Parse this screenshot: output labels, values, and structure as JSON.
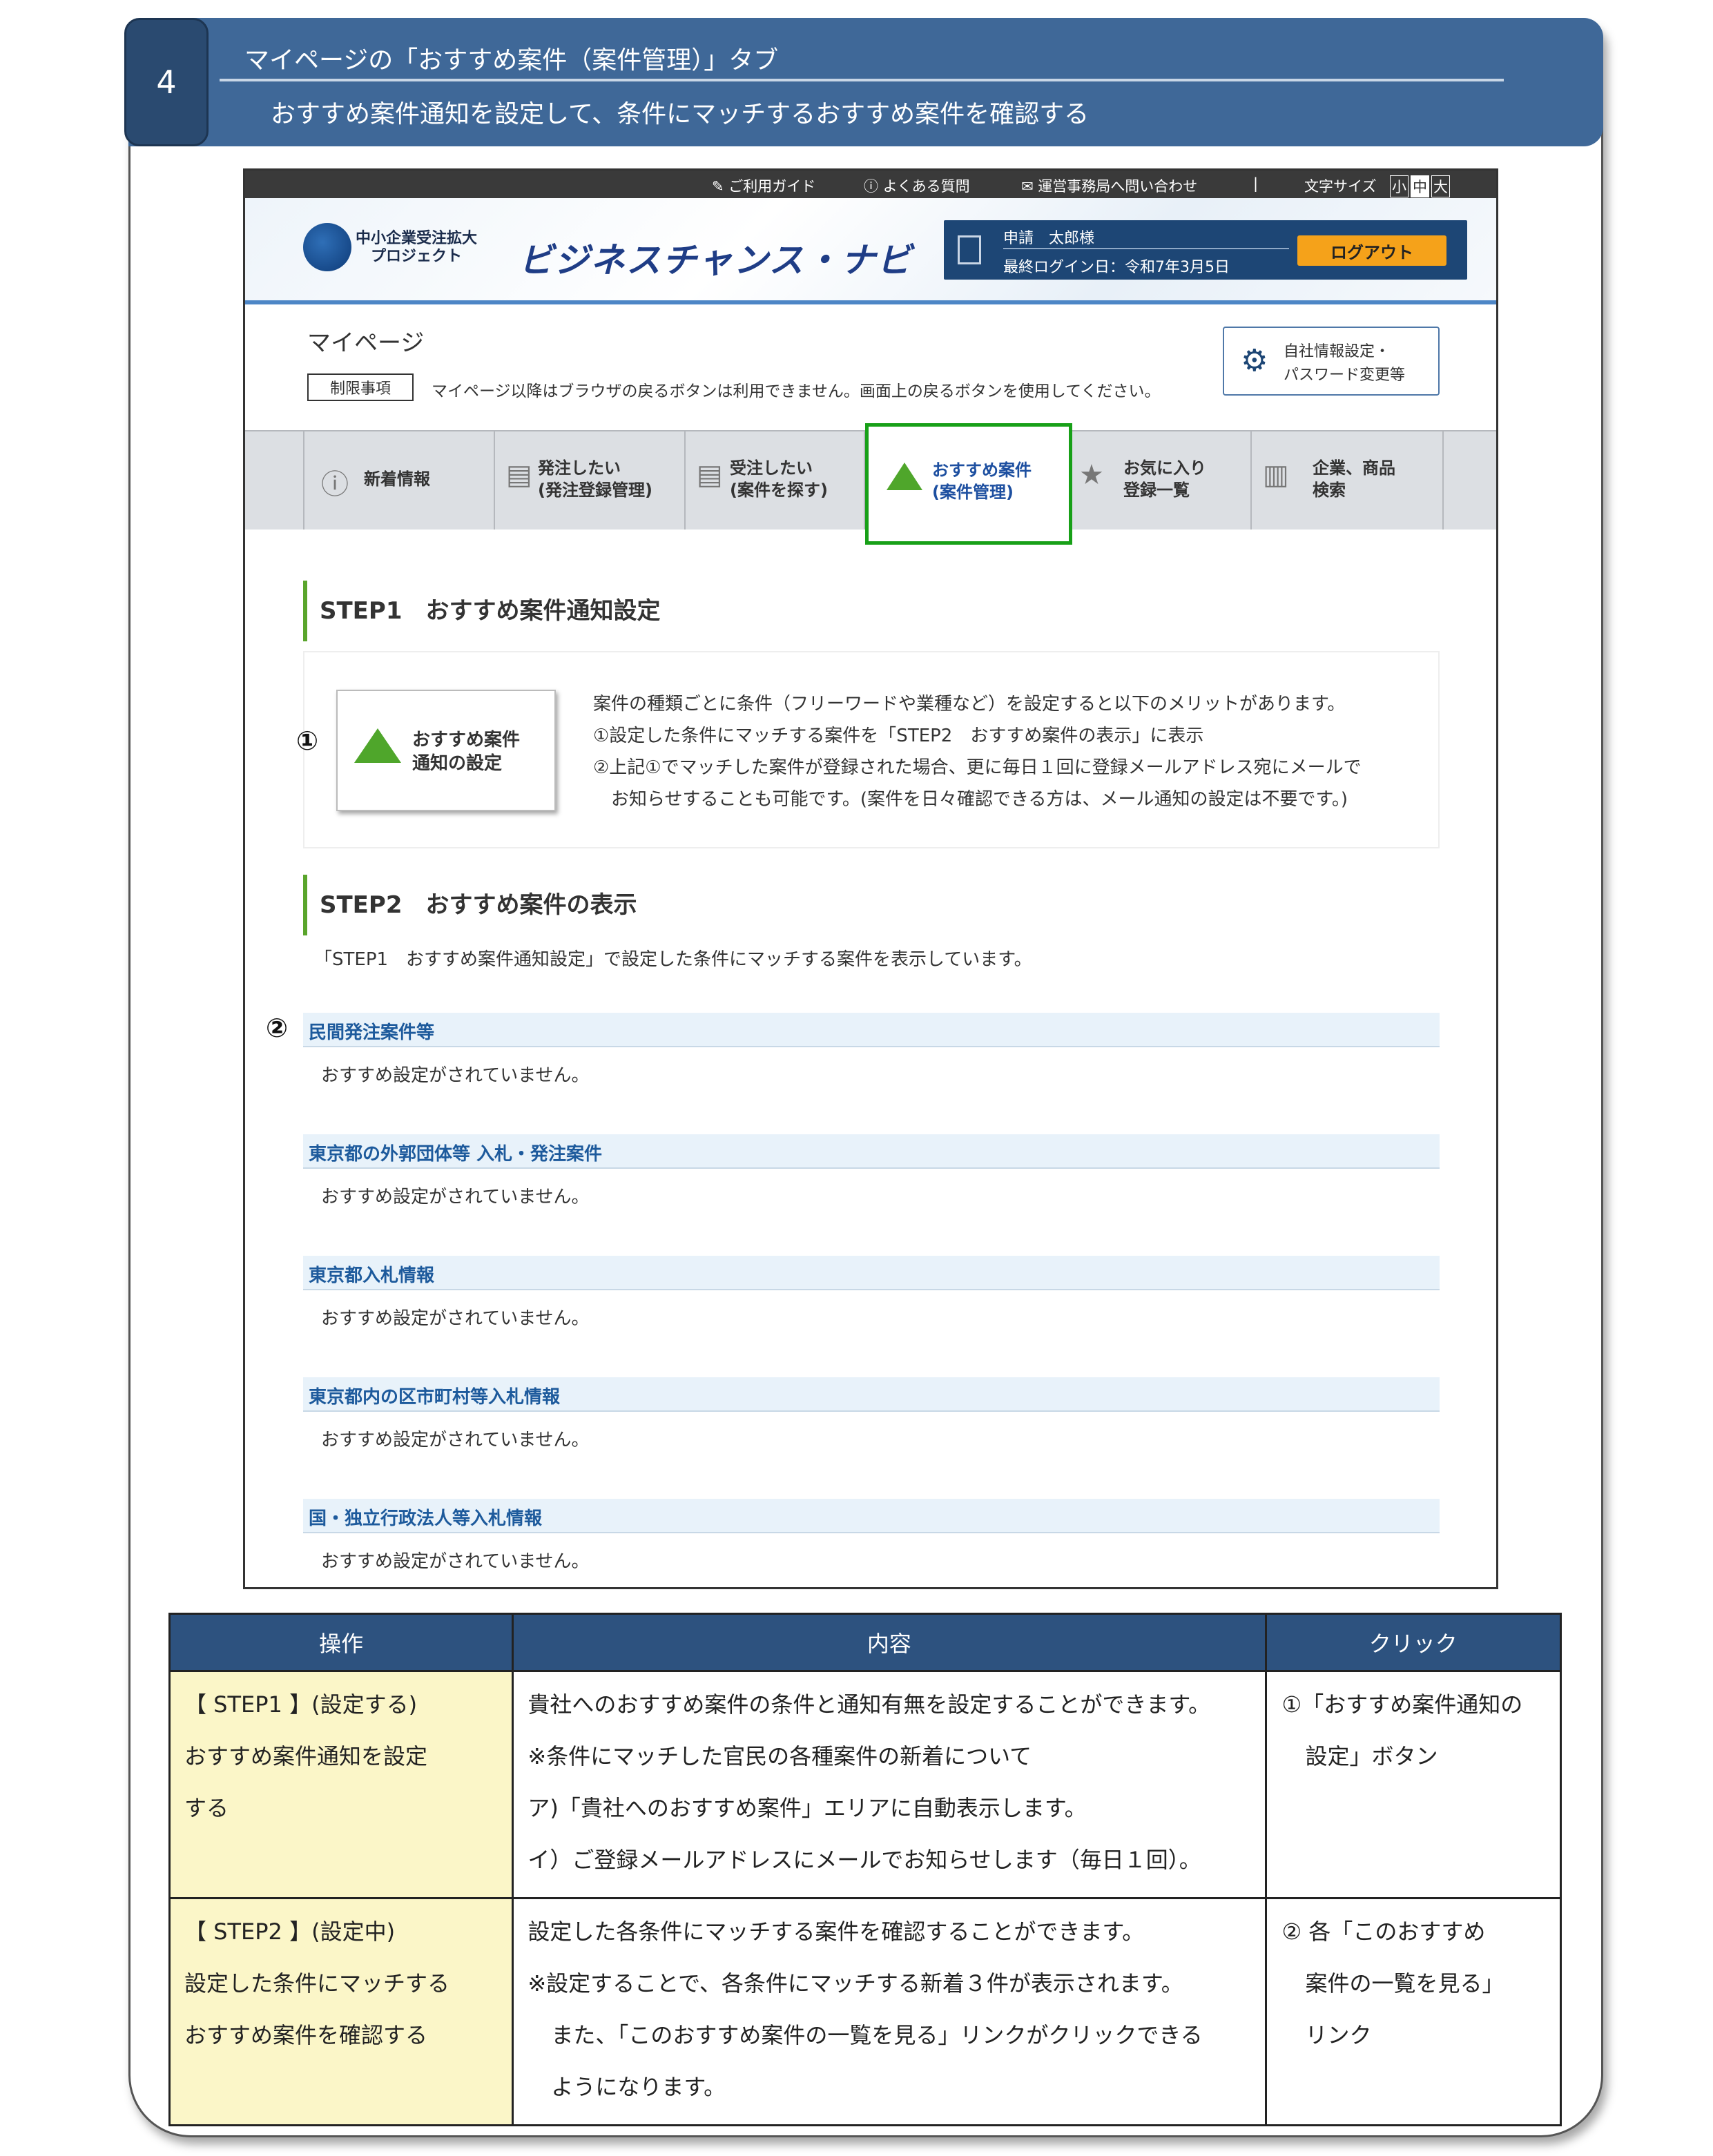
{
  "banner": {
    "number": "4",
    "title": "マイページの「おすすめ案件（案件管理）」タブ",
    "subtitle": "おすすめ案件通知を設定して、条件にマッチするおすすめ案件を確認する"
  },
  "topbar": {
    "guide": "ご利用ガイド",
    "faq": "よくある質問",
    "contact": "運営事務局へ問い合わせ",
    "sep": "|",
    "font_size": "文字サイズ",
    "size_small": "小",
    "size_mid": "中",
    "size_large": "大"
  },
  "header": {
    "logo_line1": "中小企業受注拡大",
    "logo_line2": "プロジェクト",
    "brand": "ビジネスチャンス・ナビ",
    "user": "申請　太郎様",
    "last_login": "最終ログイン日：令和7年3月5日",
    "logout": "ログアウト"
  },
  "mypage": {
    "title": "マイページ",
    "restriction_label": "制限事項",
    "restriction_text": "マイページ以降はブラウザの戻るボタンは利用できません。画面上の戻るボタンを使用してください。",
    "settings_line1": "自社情報設定・",
    "settings_line2": "パスワード変更等"
  },
  "tabs": [
    {
      "line1": "新着情報",
      "line2": ""
    },
    {
      "line1": "発注したい",
      "line2": "(発注登録管理)"
    },
    {
      "line1": "受注したい",
      "line2": "(案件を探す)"
    },
    {
      "line1": "おすすめ案件",
      "line2": "(案件管理)"
    },
    {
      "line1": "お気に入り",
      "line2": "登録一覧"
    },
    {
      "line1": "企業、商品",
      "line2": "検索"
    }
  ],
  "step1": {
    "heading": "STEP1　おすすめ案件通知設定",
    "button_line1": "おすすめ案件",
    "button_line2": "通知の設定",
    "marker": "①",
    "desc": [
      "案件の種類ごとに条件（フリーワードや業種など）を設定すると以下のメリットがあります。",
      "①設定した条件にマッチする案件を「STEP2　おすすめ案件の表示」に表示",
      "②上記①でマッチした案件が登録された場合、更に毎日１回に登録メールアドレス宛にメールで",
      "　お知らせすることも可能です。(案件を日々確認できる方は、メール通知の設定は不要です。)"
    ]
  },
  "step2": {
    "heading": "STEP2　おすすめ案件の表示",
    "subtitle": "「STEP1　おすすめ案件通知設定」で設定した条件にマッチする案件を表示しています。",
    "marker": "②",
    "categories": [
      {
        "title": "民間発注案件等",
        "note": "おすすめ設定がされていません。"
      },
      {
        "title": "東京都の外郭団体等 入札・発注案件",
        "note": "おすすめ設定がされていません。"
      },
      {
        "title": "東京都入札情報",
        "note": "おすすめ設定がされていません。"
      },
      {
        "title": "東京都内の区市町村等入札情報",
        "note": "おすすめ設定がされていません。"
      },
      {
        "title": "国・独立行政法人等入札情報",
        "note": "おすすめ設定がされていません。"
      }
    ]
  },
  "table": {
    "headers": [
      "操作",
      "内容",
      "クリック"
    ],
    "rows": [
      {
        "op": [
          "【 STEP1 】(設定する)",
          "おすすめ案件通知を設定",
          "する"
        ],
        "content": [
          "貴社へのおすすめ案件の条件と通知有無を設定することができます。",
          "※条件にマッチした官民の各種案件の新着について",
          "ア)「貴社へのおすすめ案件」エリアに自動表示します。",
          "イ）ご登録メールアドレスにメールでお知らせします（毎日１回）。"
        ],
        "click": [
          "①「おすすめ案件通知の",
          "設定」ボタン"
        ]
      },
      {
        "op": [
          "【 STEP2 】(設定中)",
          "設定した条件にマッチする",
          "おすすめ案件を確認する"
        ],
        "content": [
          "設定した各条件にマッチする案件を確認することができます。",
          "※設定することで、各条件にマッチする新着３件が表示されます。",
          "また、「このおすすめ案件の一覧を見る」リンクがクリックできる",
          "ようになります。"
        ],
        "click": [
          "② 各「このおすすめ",
          "案件の一覧を見る」",
          "リンク"
        ]
      }
    ]
  }
}
